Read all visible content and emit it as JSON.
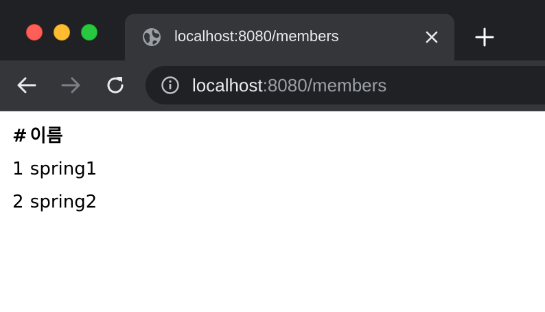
{
  "window": {
    "traffic_lights": {
      "close_color": "#ff5f57",
      "minimize_color": "#febc2e",
      "maximize_color": "#28c840"
    }
  },
  "tab": {
    "icon": "globe-icon",
    "title": "localhost:8080/members",
    "close_icon": "close-icon",
    "new_tab_icon": "plus-icon"
  },
  "toolbar": {
    "back_icon": "arrow-left-icon",
    "forward_icon": "arrow-right-icon",
    "reload_icon": "reload-icon",
    "info_icon": "info-icon",
    "url_host": "localhost",
    "url_rest": ":8080/members"
  },
  "members_table": {
    "headers": [
      "#",
      "이름"
    ],
    "rows": [
      {
        "id": "1",
        "name": "spring1"
      },
      {
        "id": "2",
        "name": "spring2"
      }
    ]
  },
  "colors": {
    "chrome_dark": "#202124",
    "chrome_tab": "#35363a",
    "chrome_text": "#e8eaed",
    "url_muted": "#9aa0a6",
    "forward_disabled": "#7b7e82"
  }
}
